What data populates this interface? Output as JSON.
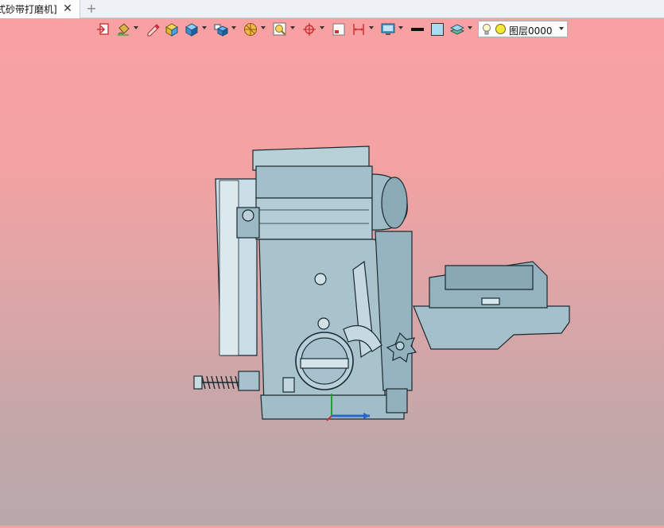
{
  "tab": {
    "title": "式砂带打磨机]",
    "close_symbol": "✕",
    "new_tab_symbol": "+"
  },
  "toolbar": {
    "buttons": [
      {
        "icon": "exit-sketch-icon",
        "dropdown": false
      },
      {
        "icon": "paint-bucket-icon",
        "dropdown": true
      },
      {
        "icon": "eraser-pen-icon",
        "dropdown": false
      },
      {
        "icon": "cube-select-icon",
        "dropdown": false
      },
      {
        "icon": "shaded-cube-icon",
        "dropdown": true
      },
      {
        "icon": "view-orient-icon",
        "dropdown": true
      },
      {
        "icon": "section-view-icon",
        "dropdown": true
      },
      {
        "icon": "zoom-fit-icon",
        "dropdown": true
      },
      {
        "icon": "crosshair-icon",
        "dropdown": true
      },
      {
        "icon": "frame-icon",
        "dropdown": false
      },
      {
        "icon": "dimension-icon",
        "dropdown": true
      },
      {
        "icon": "display-monitor-icon",
        "dropdown": true
      },
      {
        "icon": "line-color-icon",
        "dropdown": false
      },
      {
        "icon": "fill-color-icon",
        "dropdown": false
      },
      {
        "icon": "layers-icon",
        "dropdown": true
      }
    ],
    "layer": {
      "name": "图层0000",
      "color": "#f2e838"
    }
  },
  "colors": {
    "accent": "#2a66c8",
    "model_fill": "#a8c4cf",
    "model_stroke": "#1a2a30"
  },
  "viewport": {
    "model_name_icon": "sander-3d-model"
  }
}
